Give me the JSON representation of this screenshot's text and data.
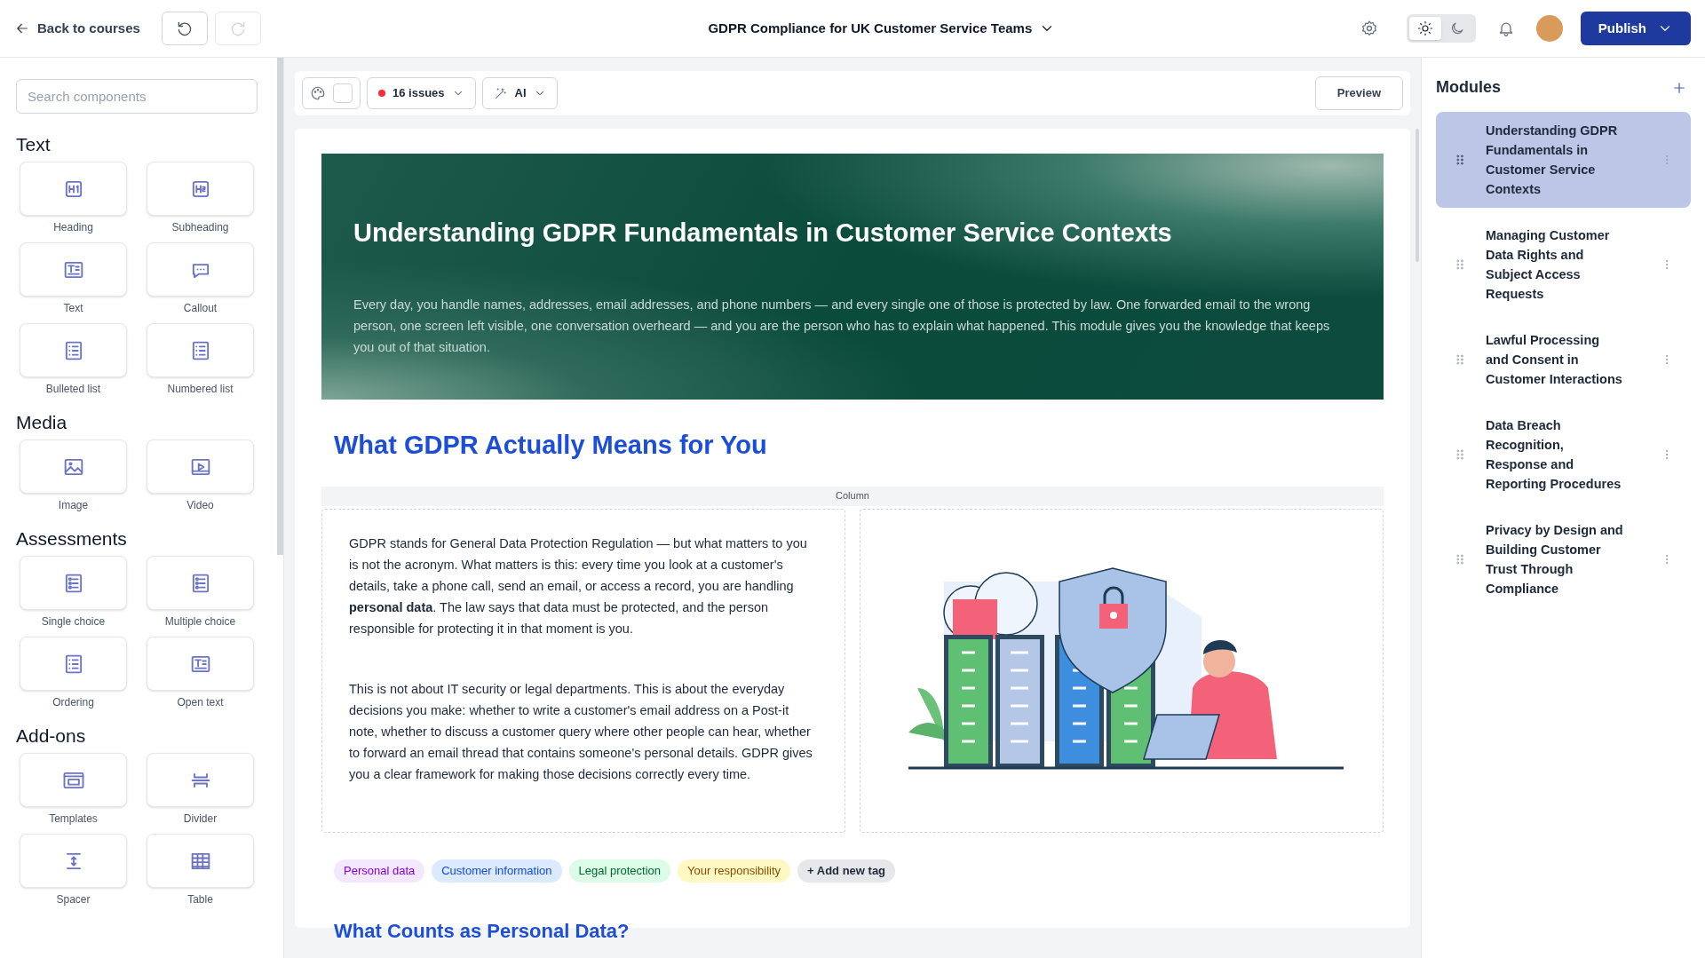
{
  "topbar": {
    "back": "Back to courses",
    "title": "GDPR Compliance for UK Customer Service Teams",
    "dark_mode": false,
    "publish": "Publish"
  },
  "components": {
    "search": {
      "placeholder": "Search components"
    },
    "sections": [
      {
        "title": "Text",
        "items": [
          {
            "label": "Heading",
            "kind": "heading"
          },
          {
            "label": "Subheading",
            "kind": "subheading"
          },
          {
            "label": "Text",
            "kind": "text"
          },
          {
            "label": "Callout",
            "kind": "callout"
          },
          {
            "label": "Bulleted list",
            "kind": "list"
          },
          {
            "label": "Numbered list",
            "kind": "list"
          }
        ]
      },
      {
        "title": "Media",
        "items": [
          {
            "label": "Image",
            "kind": "image"
          },
          {
            "label": "Video",
            "kind": "video"
          }
        ]
      },
      {
        "title": "Assessments",
        "items": [
          {
            "label": "Single choice",
            "kind": "choice"
          },
          {
            "label": "Multiple choice",
            "kind": "choice"
          },
          {
            "label": "Ordering",
            "kind": "list"
          },
          {
            "label": "Open text",
            "kind": "text"
          }
        ]
      },
      {
        "title": "Add-ons",
        "items": [
          {
            "label": "Templates",
            "kind": "template"
          },
          {
            "label": "Divider",
            "kind": "divider"
          },
          {
            "label": "Spacer",
            "kind": "spacer"
          },
          {
            "label": "Table",
            "kind": "table"
          }
        ]
      }
    ]
  },
  "editor_toolbar": {
    "issues": "16 issues",
    "ai": "AI",
    "preview": "Preview"
  },
  "content": {
    "hero": {
      "title": "Understanding GDPR Fundamentals in Customer Service Contexts",
      "text": "Every day, you handle names, addresses, email addresses, and phone numbers — and every single one of those is protected by law. One forwarded email to the wrong person, one screen left visible, one conversation overheard — and you are the person who has to explain what happened. This module gives you the knowledge that keeps you out of that situation."
    },
    "heading": "What GDPR Actually Means for You",
    "column_label": "Column",
    "paragraphs": [
      "GDPR stands for General Data Protection Regulation — but what matters to you is not the acronym. What matters is this: every time you look at a customer's details, take a phone call, send an email, or access a record, you are handling **personal data**. The law says that data must be protected, and the person responsible for protecting it in that moment is you.",
      "This is not about IT security or legal departments. This is about the everyday decisions you make: whether to write a customer's email address on a Post-it note, whether to discuss a customer query where other people can hear, whether to forward an email thread that contains someone's personal details. GDPR gives you a clear framework for making those decisions correctly every time."
    ],
    "tags": [
      {
        "label": "Personal data",
        "color": "#f3e8ff"
      },
      {
        "label": "Customer information",
        "color": "#dbeafe"
      },
      {
        "label": "Legal protection",
        "color": "#dcfce7"
      },
      {
        "label": "Your responsibility",
        "color": "#fef9c3"
      }
    ],
    "add_tag": "+ Add new tag",
    "subheading": "What Counts as Personal Data?"
  },
  "modules": {
    "title": "Modules",
    "items": [
      {
        "title": "Understanding GDPR Fundamentals in Customer Service Contexts",
        "selected": true
      },
      {
        "title": "Managing Customer Data Rights and Subject Access Requests",
        "selected": false
      },
      {
        "title": "Lawful Processing and Consent in Customer Interactions",
        "selected": false
      },
      {
        "title": "Data Breach Recognition, Response and Reporting Procedures",
        "selected": false
      },
      {
        "title": "Privacy by Design and Building Customer Trust Through Compliance",
        "selected": false
      }
    ]
  }
}
